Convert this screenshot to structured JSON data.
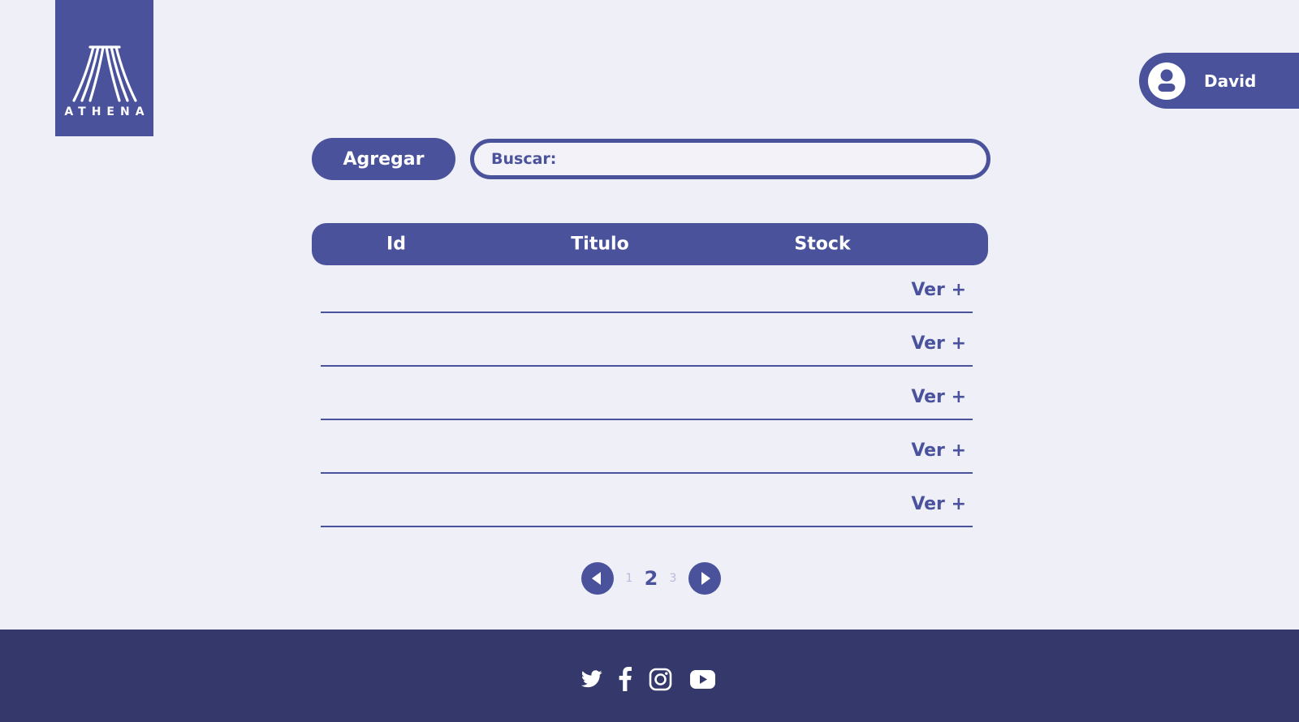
{
  "brand": {
    "logo_text": "ATHENA"
  },
  "user": {
    "name": "David",
    "icon": "user-avatar-icon"
  },
  "toolbar": {
    "add_label": "Agregar",
    "search_label": "Buscar:",
    "search_value": ""
  },
  "table": {
    "columns": [
      "Id",
      "Titulo",
      "Stock"
    ],
    "rows": [
      {
        "id": "",
        "titulo": "",
        "stock": "",
        "action": "Ver +"
      },
      {
        "id": "",
        "titulo": "",
        "stock": "",
        "action": "Ver +"
      },
      {
        "id": "",
        "titulo": "",
        "stock": "",
        "action": "Ver +"
      },
      {
        "id": "",
        "titulo": "",
        "stock": "",
        "action": "Ver +"
      },
      {
        "id": "",
        "titulo": "",
        "stock": "",
        "action": "Ver +"
      }
    ]
  },
  "pagination": {
    "pages": [
      "1",
      "2",
      "3"
    ],
    "current": "2"
  },
  "footer": {
    "social": [
      "twitter-icon",
      "facebook-icon",
      "instagram-icon",
      "youtube-icon"
    ]
  },
  "colors": {
    "accent": "#4a529c",
    "footer": "#34386a",
    "background": "#efeff7",
    "dim": "#b7b9d8"
  }
}
